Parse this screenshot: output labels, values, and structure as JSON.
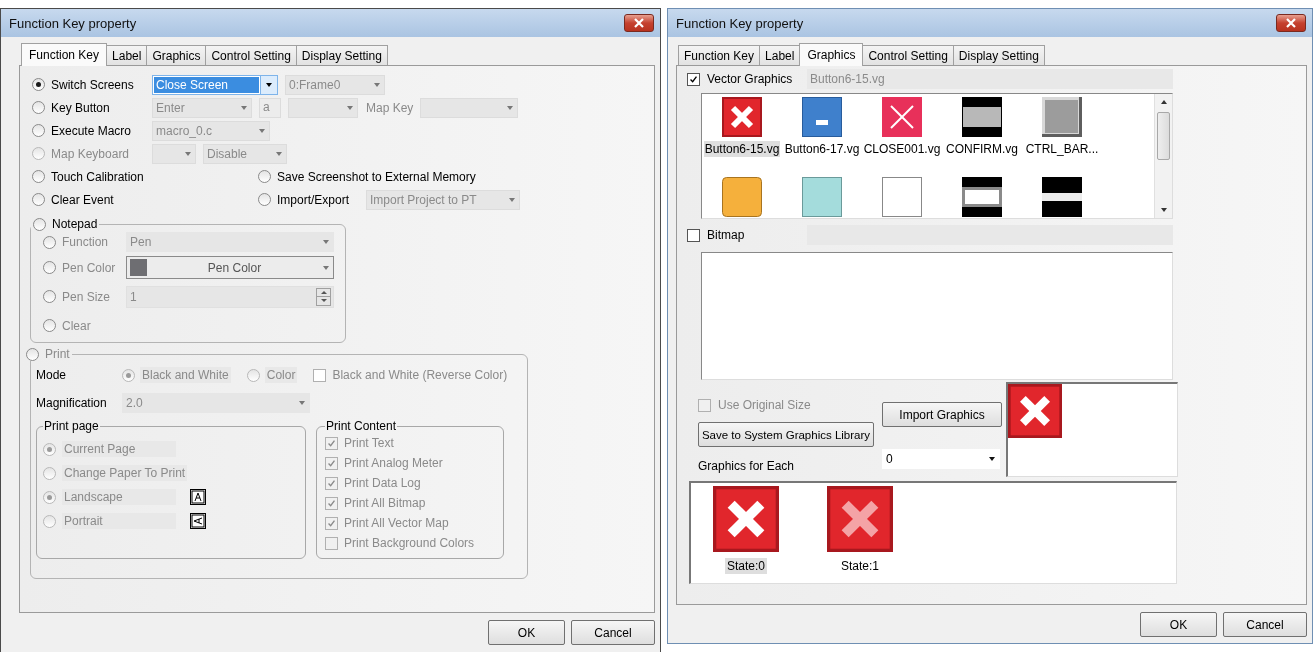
{
  "left_dialog": {
    "title": "Function Key property",
    "tabs": [
      {
        "label": "Function Key",
        "selected": true
      },
      {
        "label": "Label",
        "selected": false
      },
      {
        "label": "Graphics",
        "selected": false
      },
      {
        "label": "Control Setting",
        "selected": false
      },
      {
        "label": "Display Setting",
        "selected": false
      }
    ],
    "rows": [
      {
        "options": [
          {
            "label": "Switch Screens",
            "selected": true,
            "disabled": false,
            "controls": [
              {
                "kind": "combo",
                "value": "Close Screen",
                "focused": true
              },
              {
                "kind": "combo",
                "value": "0:Frame0",
                "focused": false
              }
            ]
          }
        ]
      },
      {
        "options": [
          {
            "label": "Key Button",
            "selected": false,
            "disabled": false,
            "controls": [
              {
                "kind": "combo",
                "value": "Enter",
                "focused": false
              },
              {
                "kind": "text",
                "value": "a"
              },
              {
                "kind": "combo",
                "focused": false
              },
              {
                "kind": "caption",
                "value": "Map Key"
              },
              {
                "kind": "combo",
                "focused": false
              }
            ]
          }
        ]
      },
      {
        "options": [
          {
            "label": "Execute Macro",
            "selected": false,
            "disabled": false,
            "controls": [
              {
                "kind": "combo",
                "value": "macro_0.c",
                "focused": false
              }
            ]
          }
        ]
      },
      {
        "options": [
          {
            "label": "Map Keyboard",
            "selected": false,
            "disabled": true,
            "controls": [
              {
                "kind": "combo",
                "focused": false
              },
              {
                "kind": "combo",
                "value": "Disable",
                "focused": false
              }
            ]
          }
        ]
      },
      {
        "options": [
          {
            "label": "Touch Calibration",
            "selected": false,
            "disabled": false
          },
          {
            "label": "Save Screenshot to External Memory",
            "selected": false,
            "disabled": false
          }
        ]
      },
      {
        "options": [
          {
            "label": "Clear Event",
            "selected": false,
            "disabled": false
          },
          {
            "label": "Import/Export",
            "selected": false,
            "disabled": false,
            "controls": [
              {
                "kind": "combo",
                "value": "Import Project to PT",
                "focused": false
              }
            ]
          }
        ]
      }
    ],
    "notepad": {
      "label": "Notepad",
      "selected": false,
      "items": [
        {
          "kind": "combo",
          "label": "Function",
          "value": "Pen",
          "selected": false
        },
        {
          "kind": "color",
          "label": "Pen Color",
          "value": "Pen Color",
          "selected": false
        },
        {
          "kind": "spin",
          "label": "Pen Size",
          "value": "1",
          "selected": false
        },
        {
          "kind": "none",
          "label": "Clear",
          "selected": false
        }
      ]
    },
    "print": {
      "label": "Print",
      "selected": false,
      "mode_label": "Mode",
      "modes": [
        {
          "label": "Black and White",
          "selected": true
        },
        {
          "label": "Color",
          "selected": false
        }
      ],
      "reverse": {
        "label": "Black and White (Reverse Color)",
        "checked": false
      },
      "magnification_label": "Magnification",
      "magnification": "2.0",
      "print_page": {
        "title": "Print page",
        "options": [
          {
            "label": "Current Page",
            "selected": true
          },
          {
            "label": "Change Paper To Print",
            "selected": false
          },
          {
            "label": "Landscape",
            "selected": true,
            "kind": "landscape"
          },
          {
            "label": "Portrait",
            "selected": false,
            "kind": "portrait"
          }
        ]
      },
      "print_content": {
        "title": "Print Content",
        "items": [
          {
            "label": "Print Text",
            "checked": true
          },
          {
            "label": "Print Analog Meter",
            "checked": true
          },
          {
            "label": "Print Data Log",
            "checked": true
          },
          {
            "label": "Print All Bitmap",
            "checked": true
          },
          {
            "label": "Print All Vector Map",
            "checked": true
          },
          {
            "label": "Print Background Colors",
            "checked": false
          }
        ]
      }
    },
    "buttons": [
      "OK",
      "Cancel"
    ]
  },
  "right_dialog": {
    "title": "Function Key property",
    "tabs": [
      {
        "label": "Function Key",
        "selected": false
      },
      {
        "label": "Label",
        "selected": false
      },
      {
        "label": "Graphics",
        "selected": true
      },
      {
        "label": "Control Setting",
        "selected": false
      },
      {
        "label": "Display Setting",
        "selected": false
      }
    ],
    "vector_graphics": {
      "label": "Vector Graphics",
      "checked": true,
      "file": "Button6-15.vg"
    },
    "gallery": [
      {
        "label": "Button6-15.vg",
        "kind": "red-x",
        "selected": true
      },
      {
        "label": "Button6-17.vg",
        "kind": "blue-minus",
        "selected": false
      },
      {
        "label": "CLOSE001.vg",
        "kind": "pink-x",
        "selected": false
      },
      {
        "label": "CONFIRM.vg",
        "kind": "gray-bar",
        "selected": false
      },
      {
        "label": "CTRL_BAR...",
        "kind": "gray-button",
        "selected": false
      },
      {
        "kind": "orange-square",
        "selected": false
      },
      {
        "kind": "cyan-square",
        "selected": false
      },
      {
        "kind": "white-square",
        "selected": false
      },
      {
        "kind": "outlined-bar",
        "selected": false
      },
      {
        "kind": "white-bar",
        "selected": false
      }
    ],
    "bitmap": {
      "label": "Bitmap",
      "checked": false
    },
    "use_original_size": {
      "label": "Use Original Size",
      "checked": false,
      "disabled": true
    },
    "import_button": "Import Graphics",
    "save_button": "Save to System Graphics Library",
    "graphics_for_each": {
      "label": "Graphics for Each",
      "value": "0"
    },
    "preview": {
      "kind": "red-x"
    },
    "states": [
      {
        "label": "State:0",
        "kind": "red-x",
        "selected": true
      },
      {
        "label": "State:1",
        "kind": "red-x-faded",
        "selected": false
      }
    ],
    "buttons": [
      "OK",
      "Cancel"
    ]
  }
}
